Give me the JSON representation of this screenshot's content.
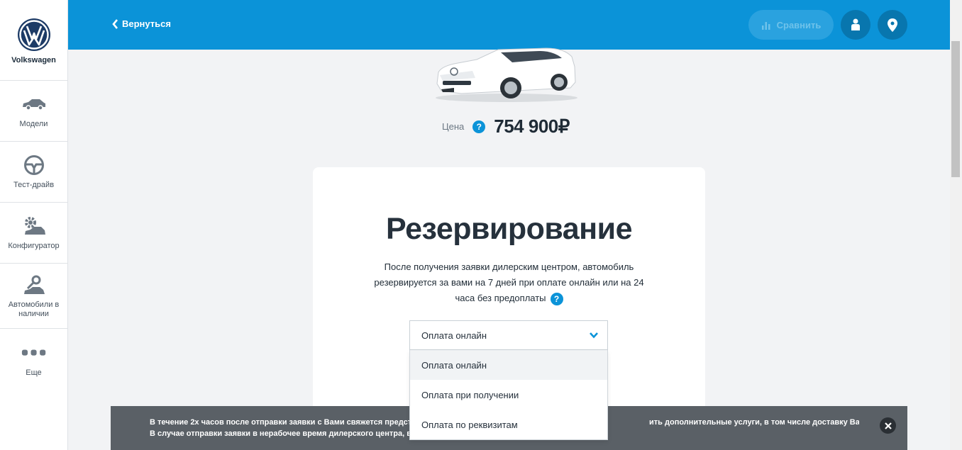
{
  "brand": {
    "name": "Volkswagen",
    "logo_icon": "vw-logo"
  },
  "sidebar": {
    "items": [
      {
        "label": "Модели",
        "icon": "car-icon"
      },
      {
        "label": "Тест-драйв",
        "icon": "steering-wheel-icon"
      },
      {
        "label": "Конфигуратор",
        "icon": "gear-car-icon"
      },
      {
        "label": "Автомобили в наличии",
        "icon": "key-car-icon"
      },
      {
        "label": "Еще",
        "icon": "more-icon"
      }
    ]
  },
  "header": {
    "back_label": "Вернуться",
    "compare_label": "Сравнить",
    "accent": "#0b93d8"
  },
  "price": {
    "label": "Цена",
    "help": "?",
    "value": "754 900₽"
  },
  "reservation": {
    "title": "Резервирование",
    "description": "После получения заявки дилерским центром, автомобиль резервируется за вами на 7 дней при оплате онлайн или на 24 часа без предоплаты",
    "help": "?"
  },
  "payment_select": {
    "value": "Оплата онлайн",
    "options": [
      "Оплата онлайн",
      "Оплата при получении",
      "Оплата по реквизитам"
    ]
  },
  "notice": {
    "line1": "В течение 2х часов после отправки заявки с Вами свяжется представитель д",
    "line1_tail": "ить дополнительные услуги, в том числе доставку Вашего автомобиля.",
    "line2": "В случае отправки заявки в нерабочее время дилерского центра, время обр"
  }
}
